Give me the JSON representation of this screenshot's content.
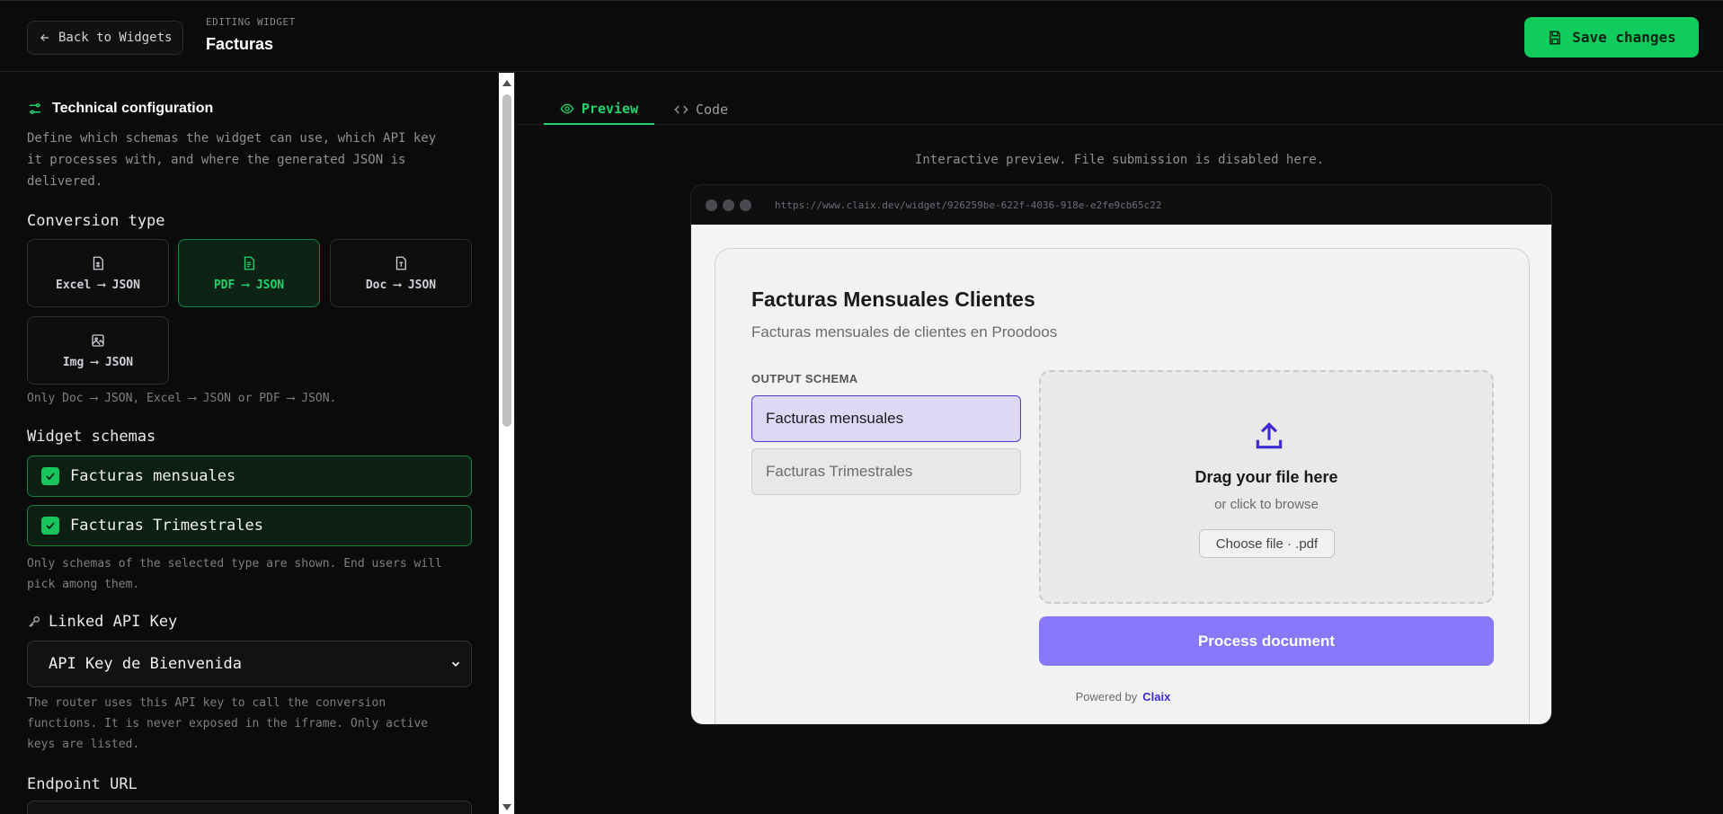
{
  "header": {
    "back_label": "Back to Widgets",
    "editing_tag": "EDITING WIDGET",
    "title": "Facturas",
    "save_label": "Save changes"
  },
  "left_panel": {
    "section_title": "Technical configuration",
    "section_desc": "Define which schemas the widget can use, which API key it processes with, and where the generated JSON is delivered.",
    "conversion_label": "Conversion type",
    "conversion_types": [
      {
        "label": "Excel ⟶ JSON",
        "icon": "spreadsheet-icon",
        "active": false
      },
      {
        "label": "PDF ⟶ JSON",
        "icon": "pdf-file-icon",
        "active": true
      },
      {
        "label": "Doc ⟶ JSON",
        "icon": "doc-file-icon",
        "active": false
      },
      {
        "label": "Img ⟶ JSON",
        "icon": "image-icon",
        "active": false
      }
    ],
    "conversion_hint": "Only Doc ⟶ JSON, Excel ⟶ JSON or PDF ⟶ JSON.",
    "schemas_label": "Widget schemas",
    "schemas": [
      {
        "label": "Facturas mensuales",
        "checked": true
      },
      {
        "label": "Facturas Trimestrales",
        "checked": true
      }
    ],
    "schemas_hint": "Only schemas of the selected type are shown. End users will pick among them.",
    "api_key_label": "Linked API Key",
    "api_key_value": "API Key de Bienvenida",
    "api_key_hint": "The router uses this API key to call the conversion functions. It is never exposed in the iframe. Only active keys are listed.",
    "endpoint_label": "Endpoint URL"
  },
  "right_panel": {
    "tabs": [
      {
        "label": "Preview",
        "active": true
      },
      {
        "label": "Code",
        "active": false
      }
    ],
    "preview_note": "Interactive preview. File submission is disabled here.",
    "browser_url": "https://www.claix.dev/widget/926259be-622f-4036-918e-e2fe9cb65c22",
    "widget": {
      "title": "Facturas Mensuales Clientes",
      "subtitle": "Facturas mensuales de clientes en Proodoos",
      "output_schema_label": "OUTPUT SCHEMA",
      "options": [
        "Facturas mensuales",
        "Facturas Trimestrales"
      ],
      "selected_option": "Facturas mensuales",
      "drop_title": "Drag your file here",
      "drop_sub": "or click to browse",
      "choose_file": "Choose file · .pdf",
      "process_label": "Process document",
      "powered_by": "Powered by",
      "brand": "Claix"
    }
  },
  "colors": {
    "accent_green": "#0fcc5c",
    "widget_accent": "#8778f9",
    "widget_brand": "#3b2bd0"
  }
}
